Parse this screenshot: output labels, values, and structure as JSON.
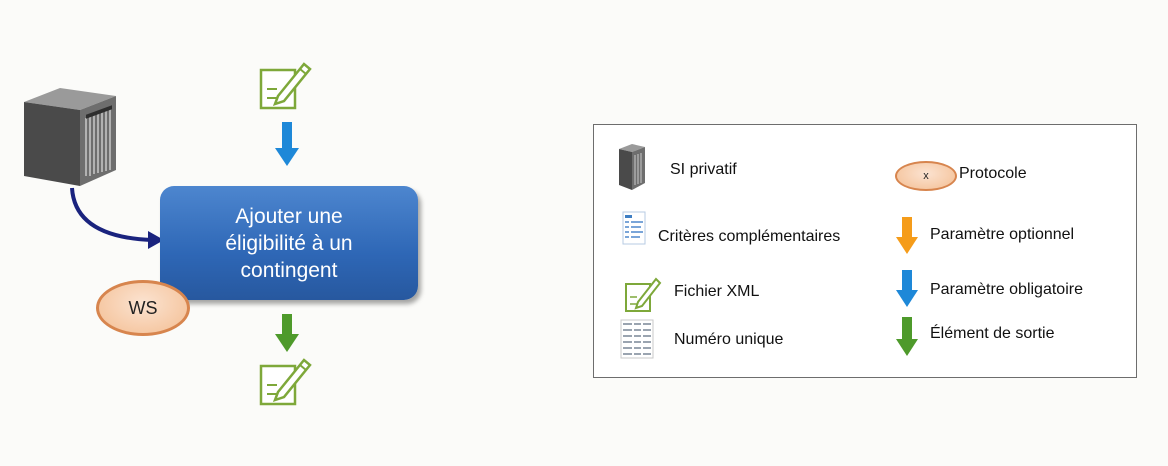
{
  "process": {
    "line1": "Ajouter une",
    "line2": "éligibilité à un",
    "line3": "contingent"
  },
  "protocol_badge": "WS",
  "legend": {
    "si_privatif": "SI privatif",
    "protocole_symbol": "x",
    "protocole": "Protocole",
    "criteres": "Critères  complémentaires",
    "parametre_optionnel": "Paramètre optionnel",
    "fichier_xml": "Fichier XML",
    "parametre_obligatoire": "Paramètre obligatoire",
    "numero_unique": "Numéro unique",
    "element_sortie": "Élément de sortie"
  },
  "colors": {
    "process_blue": "#2e67b6",
    "mandatory_arrow": "#1e88d8",
    "optional_arrow": "#f59c1a",
    "output_arrow": "#4e9a2b",
    "xml_icon_green": "#7ea83a",
    "protocol_orange": "#f6c9a5",
    "connector_navy": "#1a237e"
  }
}
